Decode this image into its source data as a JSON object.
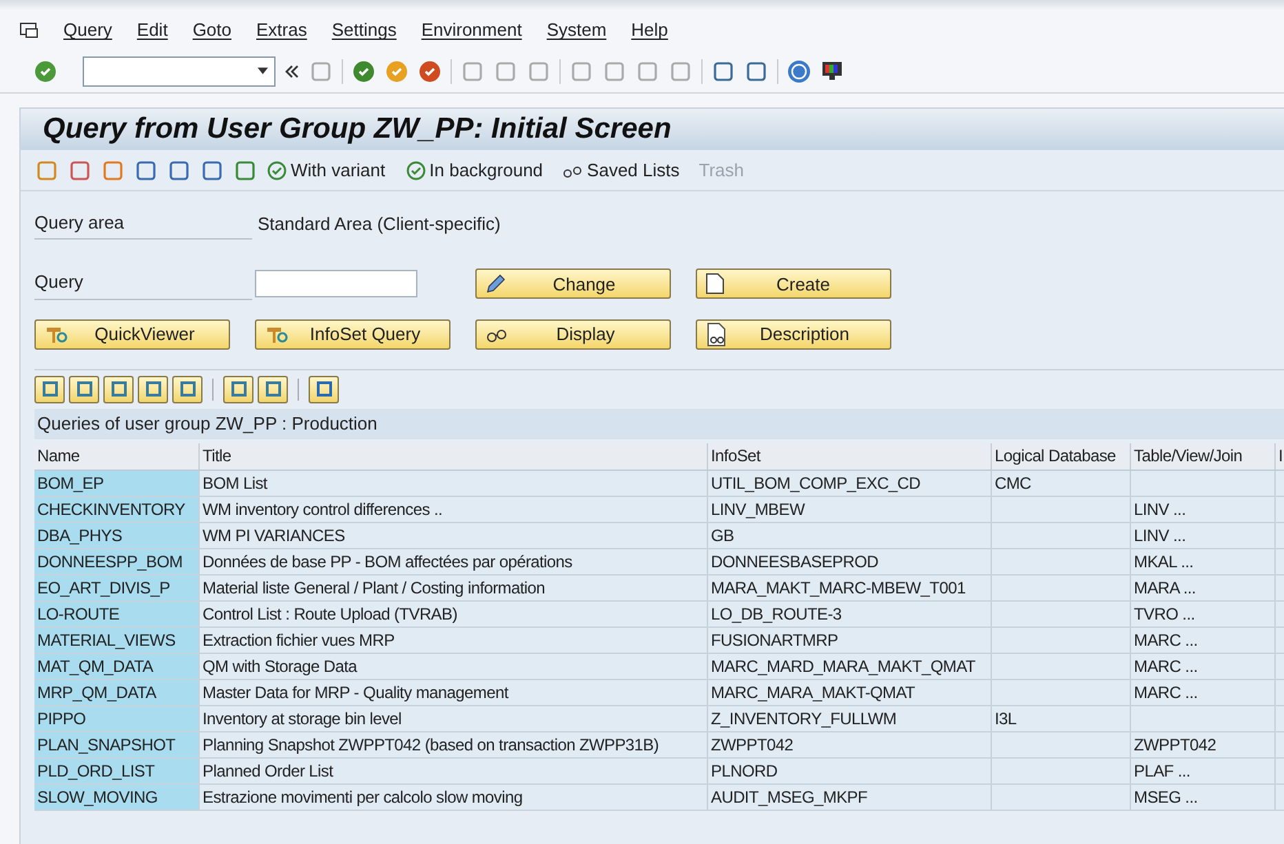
{
  "menu": [
    {
      "label": "Query"
    },
    {
      "label": "Edit"
    },
    {
      "label": "Goto"
    },
    {
      "label": "Extras"
    },
    {
      "label": "Settings"
    },
    {
      "label": "Environment"
    },
    {
      "label": "System"
    },
    {
      "label": "Help"
    }
  ],
  "title": "Query from User Group ZW_PP: Initial Screen",
  "app_toolbar": [
    {
      "label": "With variant",
      "disabled": false
    },
    {
      "label": "In background",
      "disabled": false
    },
    {
      "label": "Saved Lists",
      "disabled": false
    },
    {
      "label": "Trash",
      "disabled": true
    }
  ],
  "query_area": {
    "label": "Query area",
    "value": "Standard Area (Client-specific)"
  },
  "query": {
    "label": "Query"
  },
  "buttons": [
    {
      "label": "Change",
      "kind": "pencil"
    },
    {
      "label": "Create",
      "kind": "page"
    },
    {
      "label": "QuickViewer",
      "kind": "tool"
    },
    {
      "label": "InfoSet Query",
      "kind": "tool"
    },
    {
      "label": "Display",
      "kind": "glasses"
    },
    {
      "label": "Description",
      "kind": "doc"
    }
  ],
  "table": {
    "caption": "Queries of user group ZW_PP : Production",
    "columns": [
      "Name",
      "Title",
      "InfoSet",
      "Logical Database",
      "Table/View/Join",
      "I"
    ],
    "rows": [
      [
        "BOM_EP",
        "BOM List",
        "UTIL_BOM_COMP_EXC_CD",
        "CMC",
        ""
      ],
      [
        "CHECKINVENTORY",
        "WM inventory control differences ..",
        "LINV_MBEW",
        "",
        "LINV ..."
      ],
      [
        "DBA_PHYS",
        "WM  PI  VARIANCES",
        "GB",
        "",
        "LINV ..."
      ],
      [
        "DONNEESPP_BOM",
        "Données de base PP - BOM affectées par opérations",
        "DONNEESBASEPROD",
        "",
        "MKAL ..."
      ],
      [
        "EO_ART_DIVIS_P",
        "Material liste General / Plant / Costing information",
        "MARA_MAKT_MARC-MBEW_T001",
        "",
        "MARA ..."
      ],
      [
        "LO-ROUTE",
        "Control List : Route Upload (TVRAB)",
        "LO_DB_ROUTE-3",
        "",
        "TVRO ..."
      ],
      [
        "MATERIAL_VIEWS",
        "Extraction fichier vues MRP",
        "FUSIONARTMRP",
        "",
        "MARC ..."
      ],
      [
        "MAT_QM_DATA",
        "QM with Storage Data",
        "MARC_MARD_MARA_MAKT_QMAT",
        "",
        "MARC ..."
      ],
      [
        "MRP_QM_DATA",
        "Master Data for MRP - Quality management",
        "MARC_MARA_MAKT-QMAT",
        "",
        "MARC ..."
      ],
      [
        "PIPPO",
        "Inventory at storage bin level",
        "Z_INVENTORY_FULLWM",
        "I3L",
        ""
      ],
      [
        "PLAN_SNAPSHOT",
        "Planning Snapshot ZWPPT042 (based on transaction ZWPP31B)",
        "ZWPPT042",
        "",
        "ZWPPT042"
      ],
      [
        "PLD_ORD_LIST",
        "Planned Order List",
        "PLNORD",
        "",
        "PLAF ..."
      ],
      [
        "SLOW_MOVING",
        "Estrazione movimenti per calcolo slow moving",
        "AUDIT_MSEG_MKPF",
        "",
        "MSEG ..."
      ]
    ]
  }
}
